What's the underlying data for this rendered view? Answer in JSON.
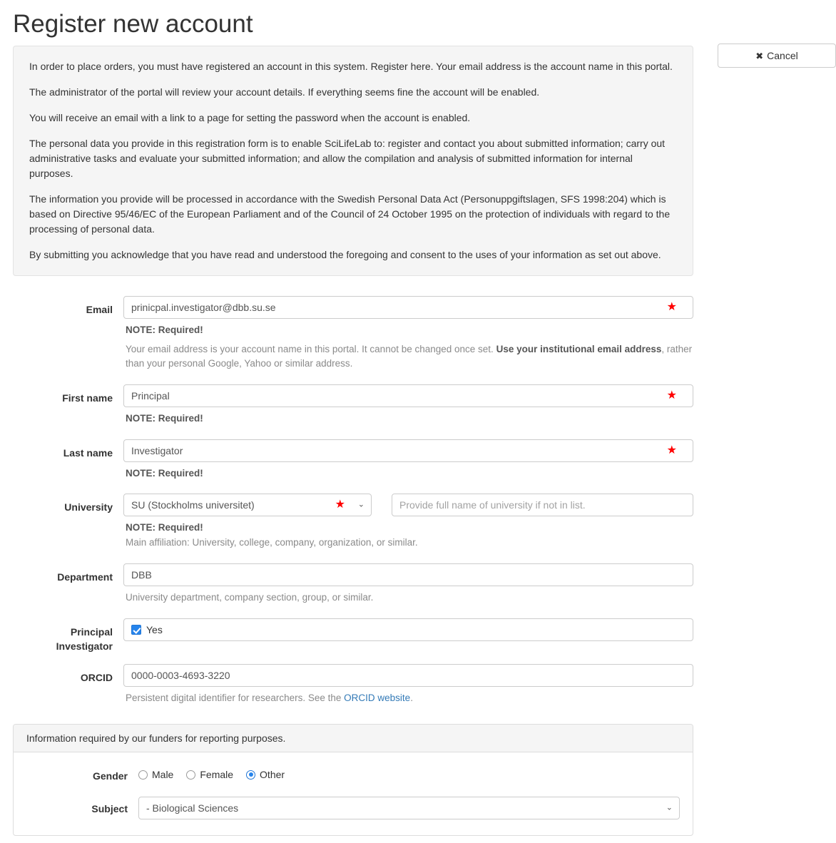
{
  "page_title": "Register new account",
  "cancel_button": {
    "icon": "✖",
    "label": "Cancel"
  },
  "intro": {
    "paragraphs": [
      "In order to place orders, you must have registered an account in this system. Register here. Your email address is the account name in this portal.",
      "The administrator of the portal will review your account details. If everything seems fine the account will be enabled.",
      "You will receive an email with a link to a page for setting the password when the account is enabled.",
      "The personal data you provide in this registration form is to enable SciLifeLab to: register and contact you about submitted information; carry out administrative tasks and evaluate your submitted information; and allow the compilation and analysis of submitted information for internal purposes.",
      "The information you provide will be processed in accordance with the Swedish Personal Data Act (Personuppgiftslagen, SFS 1998:204) which is based on Directive 95/46/EC of the European Parliament and of the Council of 24 October 1995 on the protection of individuals with regard to the processing of personal data.",
      "By submitting you acknowledge that you have read and understood the foregoing and consent to the uses of your information as set out above."
    ]
  },
  "form": {
    "required_star": "★",
    "chevron": "⌄",
    "email": {
      "label": "Email",
      "value": "prinicpal.investigator@dbb.su.se",
      "note": "NOTE: Required!",
      "help_1": "Your email address is your account name in this portal. It cannot be changed once set.",
      "help_bold": "Use your institutional email address",
      "help_2": ", rather than your personal Google, Yahoo or similar address."
    },
    "first_name": {
      "label": "First name",
      "value": "Principal",
      "note": "NOTE: Required!"
    },
    "last_name": {
      "label": "Last name",
      "value": "Investigator",
      "note": "NOTE: Required!"
    },
    "university": {
      "label": "University",
      "selected": "SU (Stockholms universitet)",
      "other_placeholder": "Provide full name of university if not in list.",
      "note": "NOTE: Required!",
      "help": "Main affiliation: University, college, company, organization, or similar."
    },
    "department": {
      "label": "Department",
      "value": "DBB",
      "help": "University department, company section, group, or similar."
    },
    "principal_investigator": {
      "label": "Principal Investigator",
      "checkbox_label": "Yes",
      "checked": true
    },
    "orcid": {
      "label": "ORCID",
      "value": "0000-0003-4693-3220",
      "help_1": "Persistent digital identifier for researchers. See the ",
      "help_link": "ORCID website",
      "help_2": "."
    }
  },
  "funders": {
    "heading": "Information required by our funders for reporting purposes.",
    "gender": {
      "label": "Gender",
      "options": [
        {
          "label": "Male",
          "selected": false
        },
        {
          "label": "Female",
          "selected": false
        },
        {
          "label": "Other",
          "selected": true
        }
      ]
    },
    "subject": {
      "label": "Subject",
      "selected": "- Biological Sciences",
      "chevron": "⌄"
    }
  },
  "colors": {
    "required_star": "#ff0000",
    "accent_blue": "#2684ec",
    "link_blue": "#337ab7",
    "panel_bg": "#f5f5f5",
    "border": "#cccccc"
  }
}
